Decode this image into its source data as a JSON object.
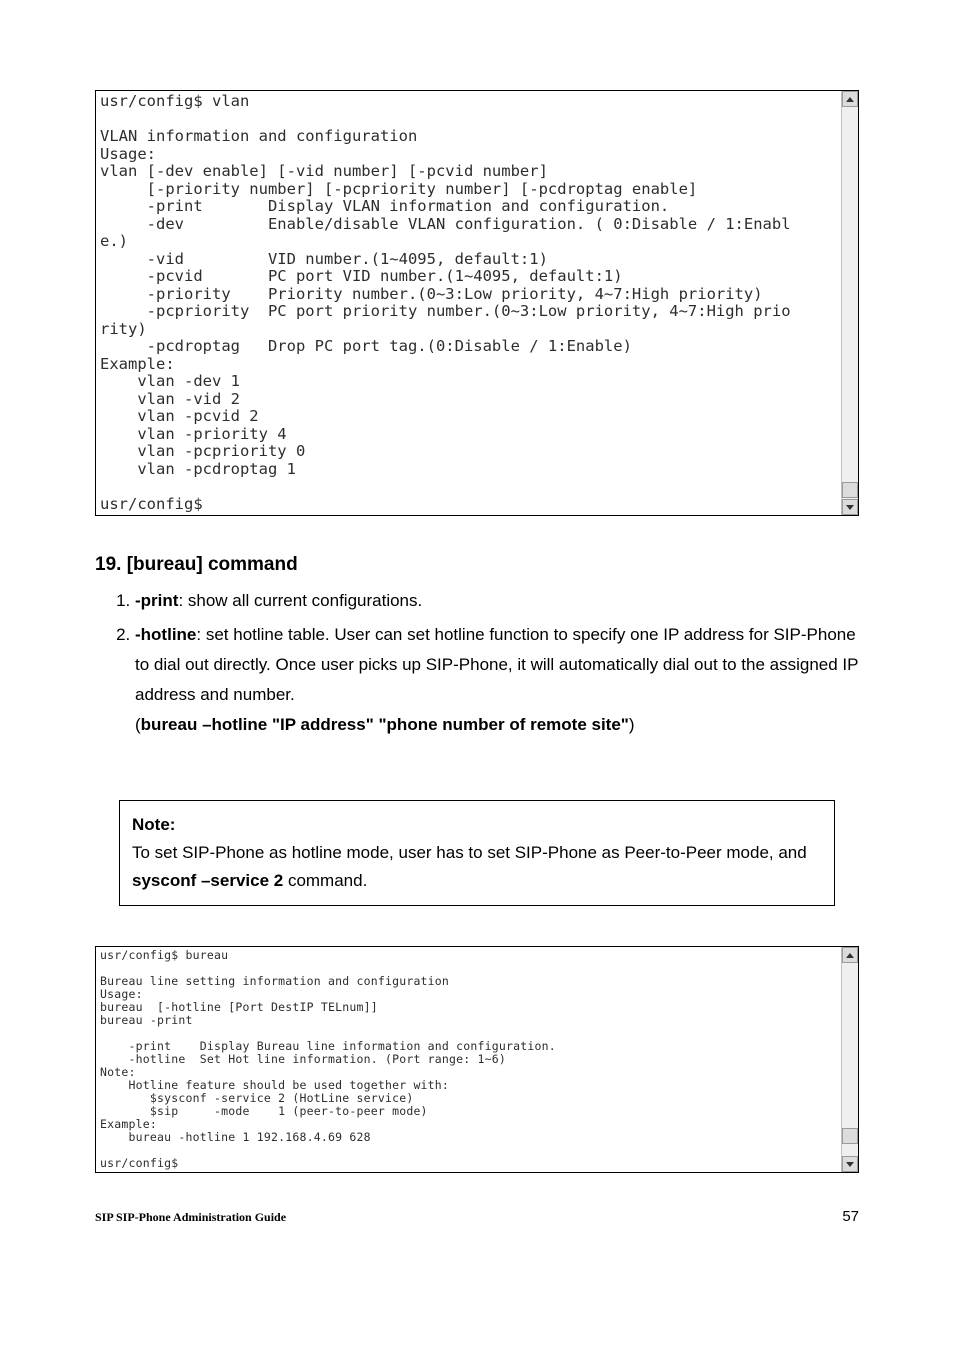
{
  "terminal1_text": "usr/config$ vlan\n\nVLAN information and configuration\nUsage:\nvlan [-dev enable] [-vid number] [-pcvid number]\n     [-priority number] [-pcpriority number] [-pcdroptag enable]\n     -print       Display VLAN information and configuration.\n     -dev         Enable/disable VLAN configuration. ( 0:Disable / 1:Enabl\ne.)\n     -vid         VID number.(1~4095, default:1)\n     -pcvid       PC port VID number.(1~4095, default:1)\n     -priority    Priority number.(0~3:Low priority, 4~7:High priority)\n     -pcpriority  PC port priority number.(0~3:Low priority, 4~7:High prio\nrity)\n     -pcdroptag   Drop PC port tag.(0:Disable / 1:Enable)\nExample:\n    vlan -dev 1\n    vlan -vid 2\n    vlan -pcvid 2\n    vlan -priority 4\n    vlan -pcpriority 0\n    vlan -pcdroptag 1\n\nusr/config$",
  "section": {
    "heading": "19. [bureau] command",
    "item1_lead": "-print",
    "item1_rest": ": show all current configurations.",
    "item2_lead": "-hotline",
    "item2_rest": ": set hotline table. User can set hotline function to specify one IP address for SIP-Phone to dial out directly. Once user picks up SIP-Phone, it will automatically dial out to the assigned IP address and number.",
    "item2_cmd_open": "(",
    "item2_cmd": "bureau –hotline \"IP address\" \"phone number of remote site\"",
    "item2_cmd_close": ")"
  },
  "note": {
    "label": "Note:",
    "body_a": "To set SIP-Phone as hotline mode, user has to set SIP-Phone as Peer-to-Peer mode, and ",
    "body_b": "sysconf –service 2",
    "body_c": " command."
  },
  "terminal2_text": "usr/config$ bureau\n\nBureau line setting information and configuration\nUsage:\nbureau  [-hotline [Port DestIP TELnum]]\nbureau -print\n\n    -print    Display Bureau line information and configuration.\n    -hotline  Set Hot line information. (Port range: 1~6)\nNote:\n    Hotline feature should be used together with:\n       $sysconf -service 2 (HotLine service)\n       $sip     -mode    1 (peer-to-peer mode)\nExample:\n    bureau -hotline 1 192.168.4.69 628\n\nusr/config$",
  "footer": {
    "left": "SIP SIP-Phone    Administration Guide",
    "right": "57"
  }
}
